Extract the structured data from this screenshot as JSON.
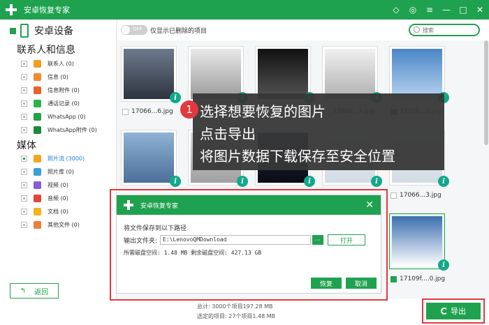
{
  "app": {
    "title": "安卓恢复专家"
  },
  "colors": {
    "brand": "#1fa24f",
    "highlight": "#e2393f",
    "info": "#12a98a",
    "active": "#1f7bd8"
  },
  "window_icons": [
    "diamond-icon",
    "chat-icon",
    "menu-icon",
    "minimize-icon",
    "close-icon"
  ],
  "sidebar": {
    "device": "安卓设备",
    "section_contacts": "联系人和信息",
    "contacts_items": [
      {
        "label": "联系人 (0)",
        "icon": "contacts-icon",
        "color": "#f0a020"
      },
      {
        "label": "信息 (0)",
        "icon": "message-icon",
        "color": "#f2892c"
      },
      {
        "label": "信息附件 (0)",
        "icon": "attachment-icon",
        "color": "#e8622c"
      },
      {
        "label": "通话记录 (0)",
        "icon": "call-log-icon",
        "color": "#2bb24c"
      },
      {
        "label": "WhatsApp (0)",
        "icon": "whatsapp-icon",
        "color": "#25a244"
      },
      {
        "label": "WhatsApp附件 (0)",
        "icon": "whatsapp-attach-icon",
        "color": "#1a8a3a"
      }
    ],
    "section_media": "媒体",
    "media_items": [
      {
        "label": "照片流 (3000)",
        "icon": "photo-stream-icon",
        "color": "#f2a51e"
      },
      {
        "label": "照片库 (0)",
        "icon": "photo-library-icon",
        "color": "#3aa0d8"
      },
      {
        "label": "视频 (0)",
        "icon": "video-icon",
        "color": "#8a5cd6"
      },
      {
        "label": "音频 (0)",
        "icon": "audio-icon",
        "color": "#e0463b"
      },
      {
        "label": "文档 (0)",
        "icon": "document-icon",
        "color": "#f3b31c"
      },
      {
        "label": "其他文件 (0)",
        "icon": "other-files-icon",
        "color": "#e8803a"
      }
    ],
    "back_label": "返回"
  },
  "topbar": {
    "toggle_text": "OFF",
    "toggle_label": "仅显示已删除的项目",
    "search_placeholder": "搜索"
  },
  "thumbnails": {
    "names": [
      "17066...6.jpg",
      "17066...4.jpg",
      "17066...8.jpg",
      "17066...3.jpg",
      "17109f....0.jpg"
    ]
  },
  "tooltip": {
    "step": "1",
    "lines": [
      "选择想要恢复的图片",
      "点击导出",
      "将图片数据下载保存至安全位置"
    ]
  },
  "dialog": {
    "title": "安卓恢复专家",
    "prompt": "将文件保存到以下路径",
    "output_label": "输出文件夹:",
    "output_path": "E:\\LenovoQMDownload",
    "browse_label": "···",
    "open_label": "打开",
    "space_text": "所需磁盘空间: 1.48 MB 剩余磁盘空间: 427.13 GB",
    "restore_label": "恢复",
    "cancel_label": "取消"
  },
  "footer": {
    "total": "总计: 3000个项目197.28 MB",
    "selected": "选定的项目: 27个项目1.48 MB",
    "export_label": "导出"
  }
}
